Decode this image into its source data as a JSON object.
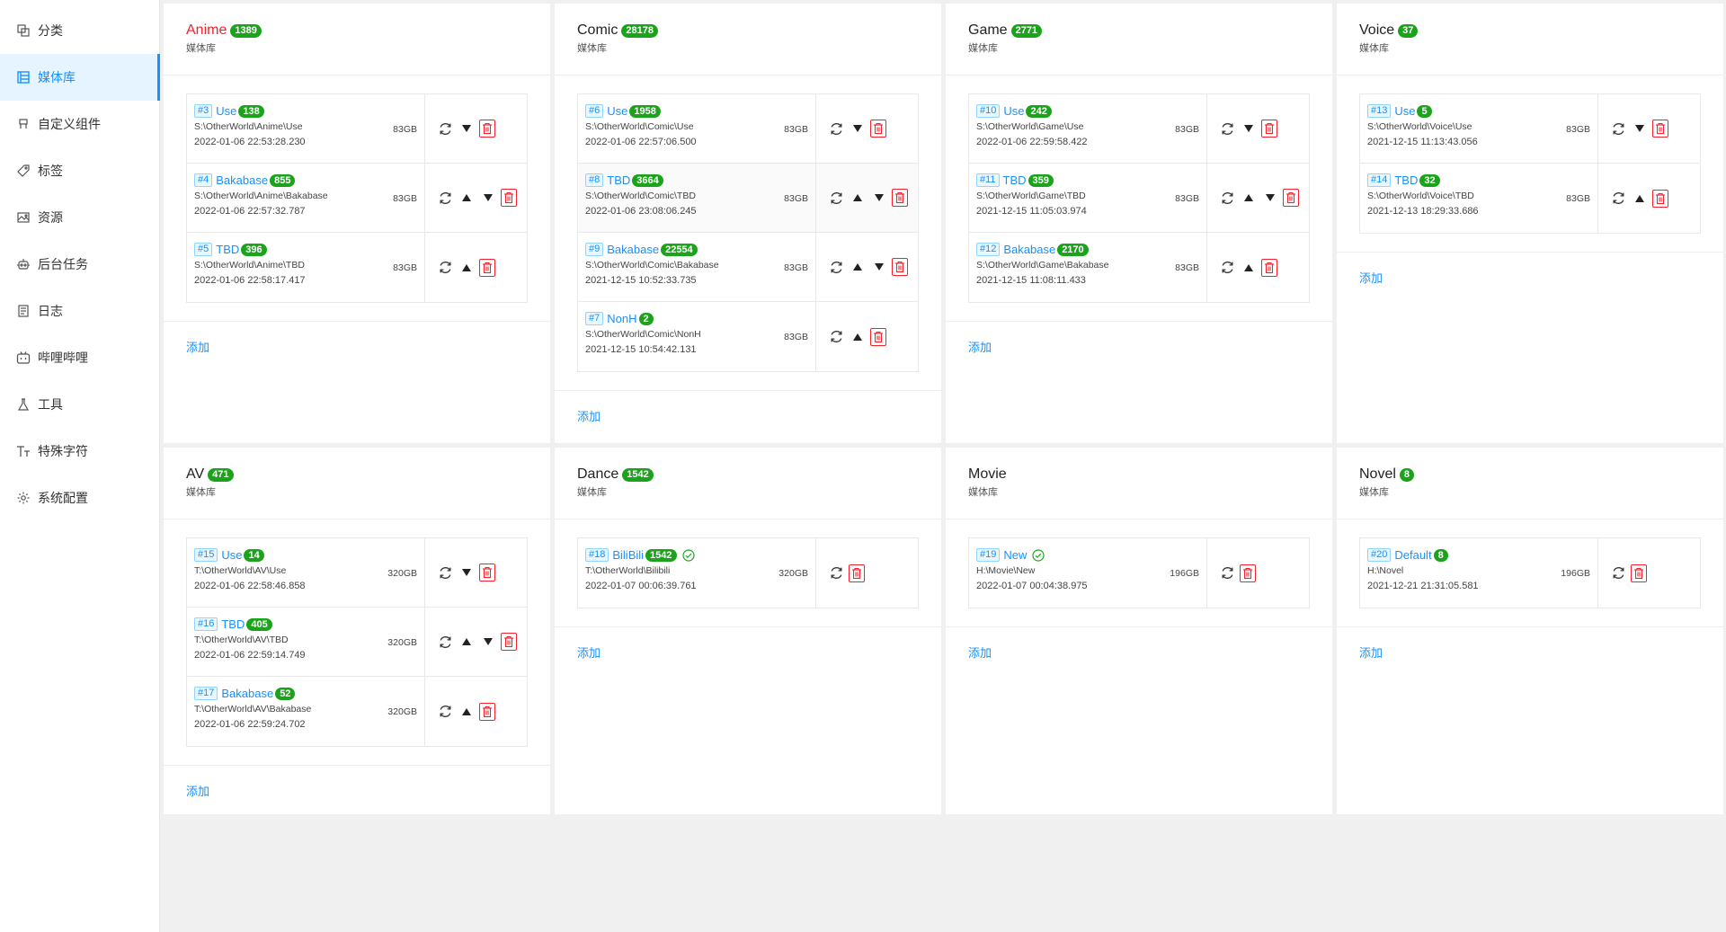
{
  "sidebar": {
    "items": [
      {
        "label": "分类",
        "icon": "category-icon",
        "active": false
      },
      {
        "label": "媒体库",
        "icon": "media-library-icon",
        "active": true
      },
      {
        "label": "自定义组件",
        "icon": "custom-component-icon",
        "active": false
      },
      {
        "label": "标签",
        "icon": "tag-icon",
        "active": false
      },
      {
        "label": "资源",
        "icon": "image-icon",
        "active": false
      },
      {
        "label": "后台任务",
        "icon": "robot-icon",
        "active": false
      },
      {
        "label": "日志",
        "icon": "log-icon",
        "active": false
      },
      {
        "label": "哔哩哔哩",
        "icon": "bilibili-icon",
        "active": false
      },
      {
        "label": "工具",
        "icon": "flask-icon",
        "active": false
      },
      {
        "label": "特殊字符",
        "icon": "font-size-icon",
        "active": false
      },
      {
        "label": "系统配置",
        "icon": "gear-icon",
        "active": false
      }
    ]
  },
  "colors": {
    "accent": "#1890ff",
    "badge_green": "#1ca31c",
    "danger": "#f5222d",
    "title_red": "#f5222d"
  },
  "common": {
    "subtitle": "媒体库",
    "add_label": "添加"
  },
  "categories": [
    {
      "title": "Anime",
      "count": "1389",
      "title_color": "red",
      "libraries": [
        {
          "id": "#3",
          "name": "Use",
          "count": "138",
          "path": "S:\\OtherWorld\\Anime\\Use",
          "size": "83GB",
          "time": "2022-01-06 22:53:28.230",
          "actions": [
            "down"
          ]
        },
        {
          "id": "#4",
          "name": "Bakabase",
          "count": "855",
          "path": "S:\\OtherWorld\\Anime\\Bakabase",
          "size": "83GB",
          "time": "2022-01-06 22:57:32.787",
          "actions": [
            "up",
            "down"
          ]
        },
        {
          "id": "#5",
          "name": "TBD",
          "count": "396",
          "path": "S:\\OtherWorld\\Anime\\TBD",
          "size": "83GB",
          "time": "2022-01-06 22:58:17.417",
          "actions": [
            "up"
          ]
        }
      ]
    },
    {
      "title": "Comic",
      "count": "28178",
      "libraries": [
        {
          "id": "#6",
          "name": "Use",
          "count": "1958",
          "path": "S:\\OtherWorld\\Comic\\Use",
          "size": "83GB",
          "time": "2022-01-06 22:57:06.500",
          "actions": [
            "down"
          ]
        },
        {
          "id": "#8",
          "name": "TBD",
          "count": "3664",
          "path": "S:\\OtherWorld\\Comic\\TBD",
          "size": "83GB",
          "time": "2022-01-06 23:08:06.245",
          "actions": [
            "up",
            "down"
          ],
          "hover": true
        },
        {
          "id": "#9",
          "name": "Bakabase",
          "count": "22554",
          "path": "S:\\OtherWorld\\Comic\\Bakabase",
          "size": "83GB",
          "time": "2021-12-15 10:52:33.735",
          "actions": [
            "up",
            "down"
          ]
        },
        {
          "id": "#7",
          "name": "NonH",
          "count": "2",
          "path": "S:\\OtherWorld\\Comic\\NonH",
          "size": "83GB",
          "time": "2021-12-15 10:54:42.131",
          "actions": [
            "up"
          ]
        }
      ]
    },
    {
      "title": "Game",
      "count": "2771",
      "libraries": [
        {
          "id": "#10",
          "name": "Use",
          "count": "242",
          "path": "S:\\OtherWorld\\Game\\Use",
          "size": "83GB",
          "time": "2022-01-06 22:59:58.422",
          "actions": [
            "down"
          ]
        },
        {
          "id": "#11",
          "name": "TBD",
          "count": "359",
          "path": "S:\\OtherWorld\\Game\\TBD",
          "size": "83GB",
          "time": "2021-12-15 11:05:03.974",
          "actions": [
            "up",
            "down"
          ]
        },
        {
          "id": "#12",
          "name": "Bakabase",
          "count": "2170",
          "path": "S:\\OtherWorld\\Game\\Bakabase",
          "size": "83GB",
          "time": "2021-12-15 11:08:11.433",
          "actions": [
            "up"
          ]
        }
      ]
    },
    {
      "title": "Voice",
      "count": "37",
      "libraries": [
        {
          "id": "#13",
          "name": "Use",
          "count": "5",
          "path": "S:\\OtherWorld\\Voice\\Use",
          "size": "83GB",
          "time": "2021-12-15 11:13:43.056",
          "actions": [
            "down"
          ]
        },
        {
          "id": "#14",
          "name": "TBD",
          "count": "32",
          "path": "S:\\OtherWorld\\Voice\\TBD",
          "size": "83GB",
          "time": "2021-12-13 18:29:33.686",
          "actions": [
            "up"
          ]
        }
      ]
    },
    {
      "title": "AV",
      "count": "471",
      "libraries": [
        {
          "id": "#15",
          "name": "Use",
          "count": "14",
          "path": "T:\\OtherWorld\\AV\\Use",
          "size": "320GB",
          "time": "2022-01-06 22:58:46.858",
          "actions": [
            "down"
          ]
        },
        {
          "id": "#16",
          "name": "TBD",
          "count": "405",
          "path": "T:\\OtherWorld\\AV\\TBD",
          "size": "320GB",
          "time": "2022-01-06 22:59:14.749",
          "actions": [
            "up",
            "down"
          ]
        },
        {
          "id": "#17",
          "name": "Bakabase",
          "count": "52",
          "path": "T:\\OtherWorld\\AV\\Bakabase",
          "size": "320GB",
          "time": "2022-01-06 22:59:24.702",
          "actions": [
            "up"
          ]
        }
      ]
    },
    {
      "title": "Dance",
      "count": "1542",
      "libraries": [
        {
          "id": "#18",
          "name": "BiliBili",
          "count": "1542",
          "path": "T:\\OtherWorld\\Bilibili",
          "size": "320GB",
          "time": "2022-01-07 00:06:39.761",
          "actions": [],
          "check": true
        }
      ]
    },
    {
      "title": "Movie",
      "count": "",
      "libraries": [
        {
          "id": "#19",
          "name": "New",
          "count": "",
          "path": "H:\\Movie\\New",
          "size": "196GB",
          "time": "2022-01-07 00:04:38.975",
          "actions": [],
          "check": true
        }
      ]
    },
    {
      "title": "Novel",
      "count": "8",
      "libraries": [
        {
          "id": "#20",
          "name": "Default",
          "count": "8",
          "path": "H:\\Novel",
          "size": "196GB",
          "time": "2021-12-21 21:31:05.581",
          "actions": []
        }
      ]
    }
  ]
}
